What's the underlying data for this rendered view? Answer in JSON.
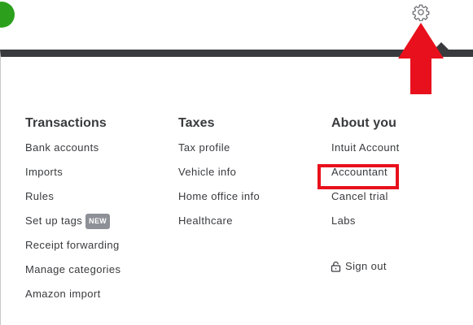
{
  "header": {
    "gear_icon": "gear-icon",
    "status_dot_color": "#2ca01c"
  },
  "annotation": {
    "arrow_color": "#e8101c",
    "highlight_color": "#e8101c"
  },
  "menu": {
    "columns": [
      {
        "heading": "Transactions",
        "items": [
          {
            "label": "Bank accounts"
          },
          {
            "label": "Imports"
          },
          {
            "label": "Rules"
          },
          {
            "label": "Set up tags",
            "badge": "NEW"
          },
          {
            "label": "Receipt forwarding"
          },
          {
            "label": "Manage categories"
          },
          {
            "label": "Amazon import"
          }
        ]
      },
      {
        "heading": "Taxes",
        "items": [
          {
            "label": "Tax profile"
          },
          {
            "label": "Vehicle info"
          },
          {
            "label": "Home office info"
          },
          {
            "label": "Healthcare"
          }
        ]
      },
      {
        "heading": "About you",
        "items": [
          {
            "label": "Intuit Account"
          },
          {
            "label": "Accountant"
          },
          {
            "label": "Cancel trial"
          },
          {
            "label": "Labs"
          }
        ]
      }
    ],
    "sign_out": {
      "label": "Sign out",
      "icon": "lock-icon"
    }
  }
}
